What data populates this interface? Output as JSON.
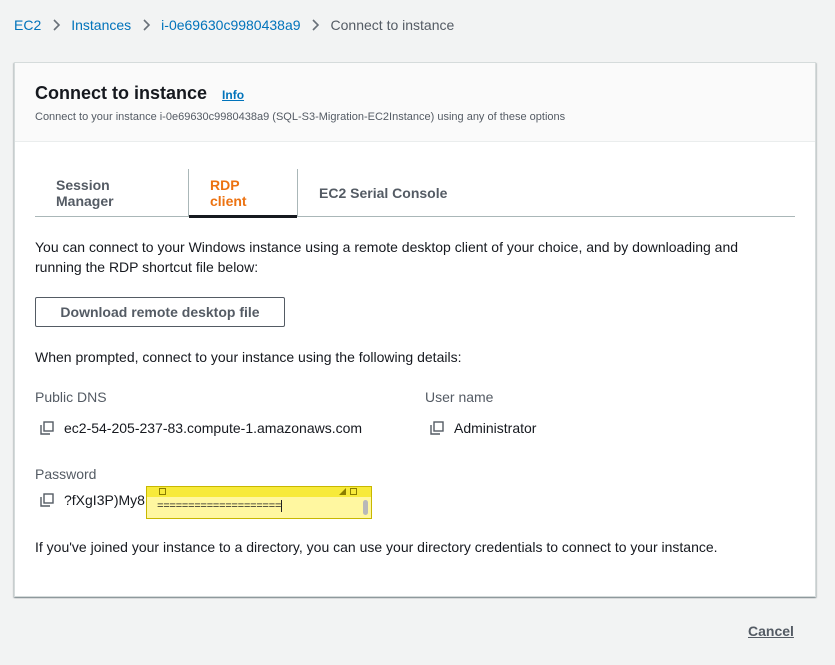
{
  "breadcrumb": {
    "items": [
      "EC2",
      "Instances",
      "i-0e69630c9980438a9"
    ],
    "current": "Connect to instance"
  },
  "panel": {
    "title": "Connect to instance",
    "info_label": "Info",
    "description": "Connect to your instance i-0e69630c9980438a9 (SQL-S3-Migration-EC2Instance) using any of these options"
  },
  "tabs": [
    {
      "label": "Session Manager",
      "active": false
    },
    {
      "label": "RDP client",
      "active": true
    },
    {
      "label": "EC2 Serial Console",
      "active": false
    }
  ],
  "rdp": {
    "intro_line1": "You can connect to your Windows instance using a remote desktop client of your choice, and by downloading and",
    "intro_line2": "running the RDP shortcut file below:",
    "download_button": "Download remote desktop file",
    "prompt_text": "When prompted, connect to your instance using the following details:",
    "public_dns_label": "Public DNS",
    "public_dns_value": "ec2-54-205-237-83.compute-1.amazonaws.com",
    "username_label": "User name",
    "username_value": "Administrator",
    "password_label": "Password",
    "password_value": "?fXgI3P)My8",
    "directory_note": "If you've joined your instance to a directory, you can use your directory credentials to connect to your instance."
  },
  "sticky_note": {
    "text": "===================="
  },
  "footer": {
    "cancel_label": "Cancel"
  },
  "colors": {
    "link": "#0073bb",
    "active_tab": "#ec7211",
    "sticky_note": "#fff7a0"
  },
  "icons": [
    "chevron-right-icon",
    "copy-icon"
  ]
}
